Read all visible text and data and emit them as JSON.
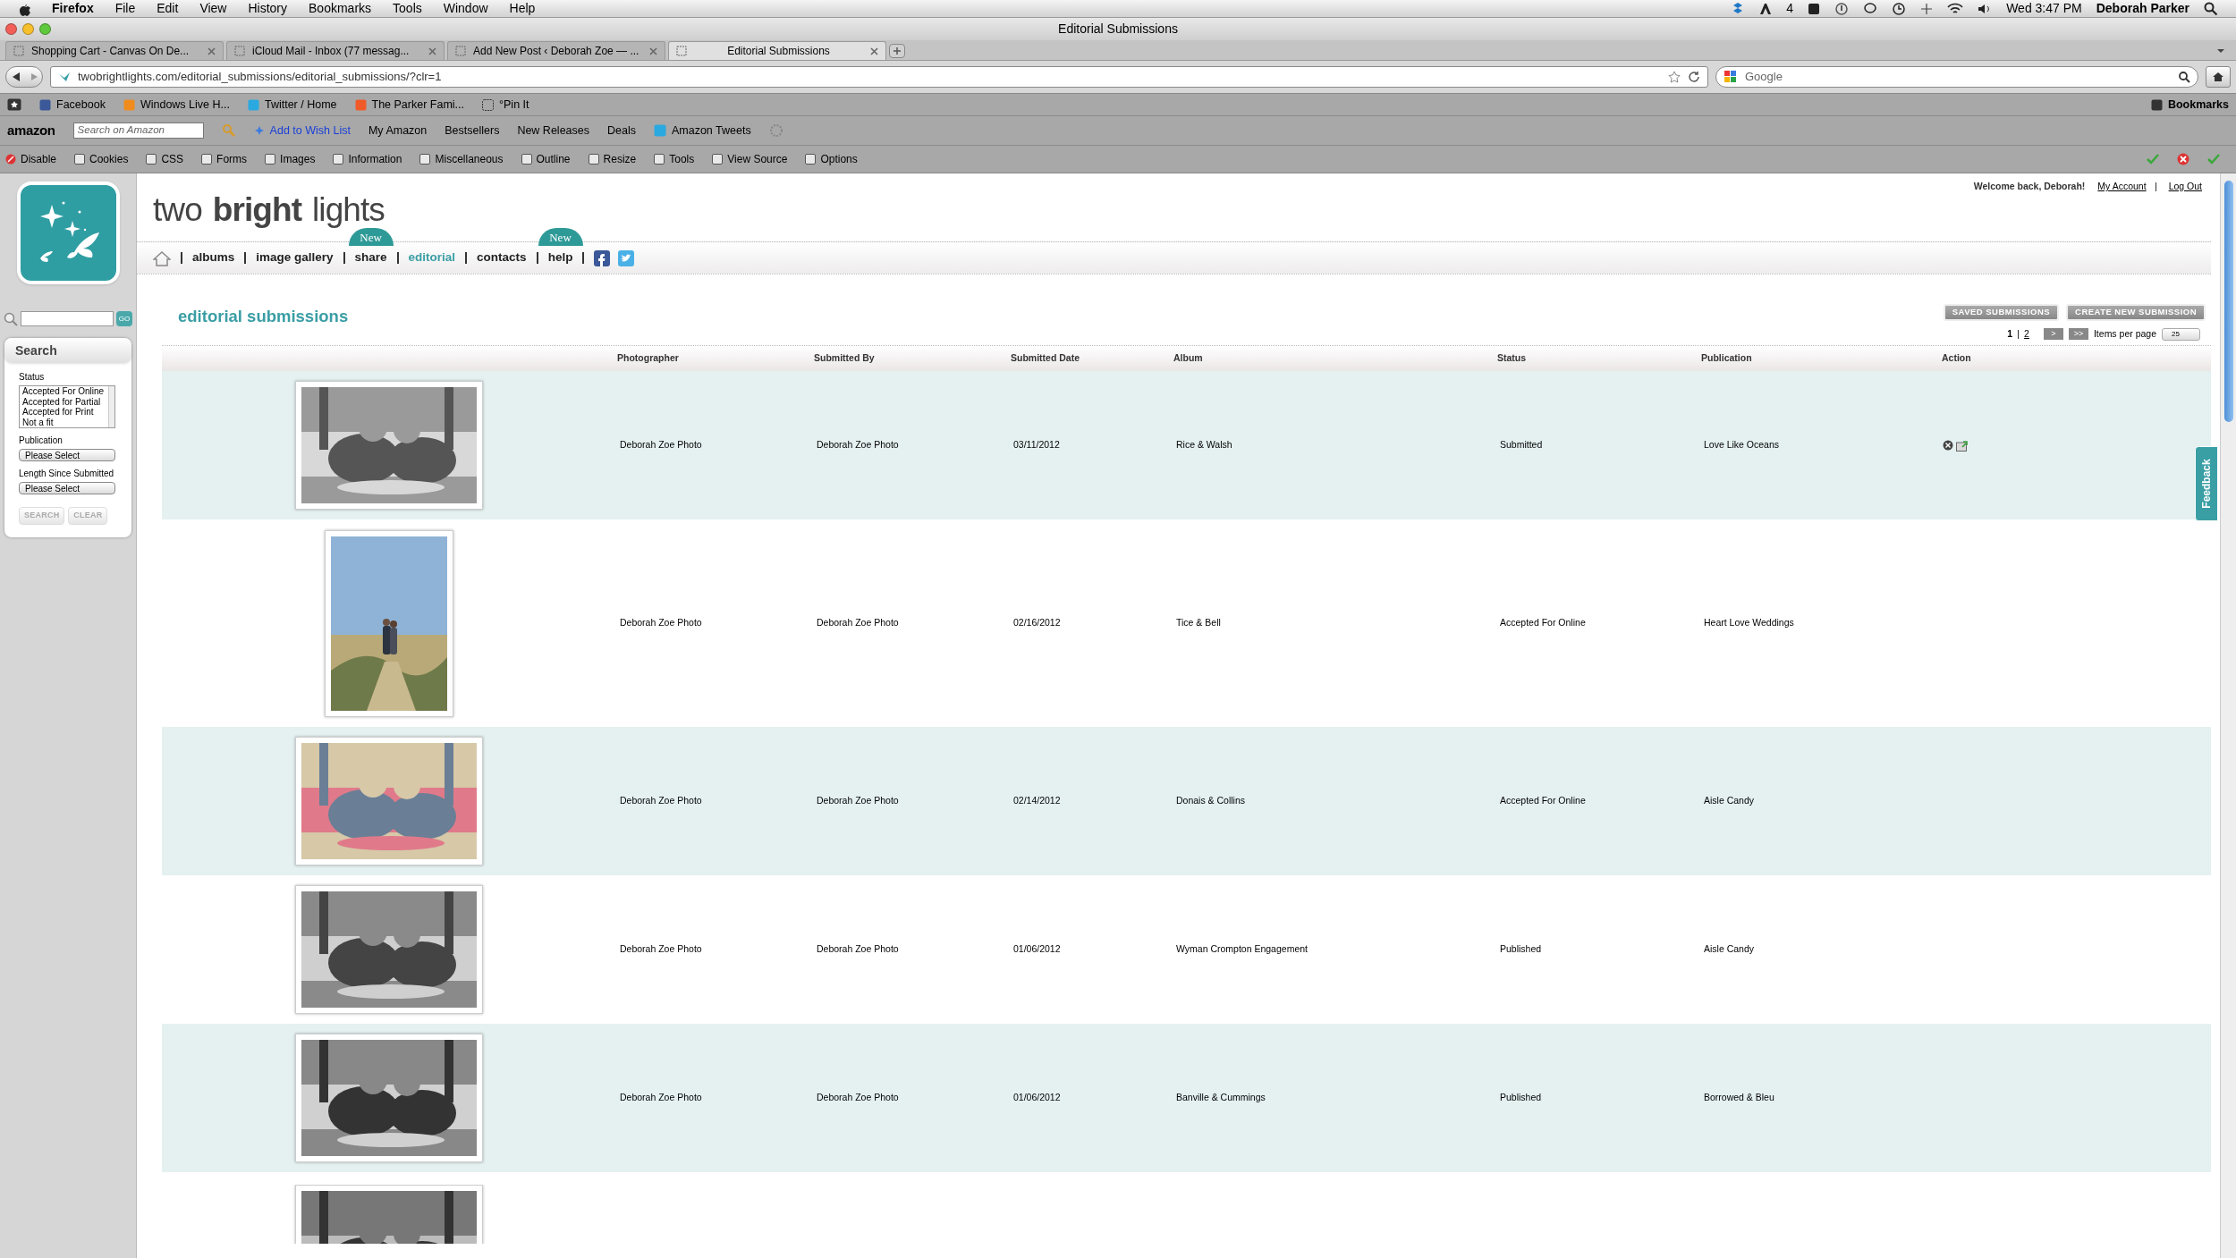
{
  "menu_bar": {
    "app": "Firefox",
    "items": [
      "File",
      "Edit",
      "View",
      "History",
      "Bookmarks",
      "Tools",
      "Window",
      "Help"
    ],
    "badge_count": "4",
    "clock": "Wed 3:47 PM",
    "user": "Deborah Parker"
  },
  "window": {
    "title": "Editorial Submissions"
  },
  "tabs": [
    {
      "label": "Shopping Cart - Canvas On De...",
      "selected": false
    },
    {
      "label": "iCloud Mail - Inbox (77 messag...",
      "selected": false
    },
    {
      "label": "Add New Post ‹ Deborah Zoe — ...",
      "selected": false
    },
    {
      "label": "Editorial Submissions",
      "selected": true
    }
  ],
  "address_bar": {
    "url": "twobrightlights.com/editorial_submissions/editorial_submissions/?clr=1"
  },
  "search_engine": {
    "placeholder": "Google"
  },
  "bookmarks_bar": {
    "items": [
      "Facebook",
      "Windows Live H...",
      "Twitter / Home",
      "The Parker Fami...",
      "°Pin It"
    ],
    "menu": "Bookmarks"
  },
  "amazon_toolbar": {
    "logo": "amazon",
    "search_placeholder": "Search on Amazon",
    "items": [
      "Add to Wish List",
      "My Amazon",
      "Bestsellers",
      "New Releases",
      "Deals",
      "Amazon Tweets"
    ]
  },
  "dev_toolbar": {
    "items": [
      "Disable",
      "Cookies",
      "CSS",
      "Forms",
      "Images",
      "Information",
      "Miscellaneous",
      "Outline",
      "Resize",
      "Tools",
      "View Source",
      "Options"
    ]
  },
  "site": {
    "logo_words": [
      "two",
      "bright",
      "lights"
    ],
    "nav": [
      {
        "label": "albums",
        "selected": false
      },
      {
        "label": "image gallery",
        "selected": false
      },
      {
        "label": "share",
        "selected": false,
        "badge": "New"
      },
      {
        "label": "editorial",
        "selected": true
      },
      {
        "label": "contacts",
        "selected": false
      },
      {
        "label": "help",
        "selected": false,
        "badge": "New"
      }
    ],
    "welcome": "Welcome back, Deborah!",
    "account_links": [
      "My Account",
      "Log Out"
    ]
  },
  "sidebar": {
    "go_button": "GO",
    "panel_title": "Search",
    "status_label": "Status",
    "status_options": [
      "Accepted For Online",
      "Accepted for Partial",
      "Accepted for Print",
      "Not a fit"
    ],
    "publication_label": "Publication",
    "publication_value": "Please Select",
    "length_label": "Length Since Submitted",
    "length_value": "Please Select",
    "buttons": [
      "SEARCH",
      "CLEAR"
    ]
  },
  "page_title": "editorial submissions",
  "actions": [
    "SAVED SUBMISSIONS",
    "CREATE NEW SUBMISSION"
  ],
  "pagination": {
    "pages": [
      {
        "label": "1",
        "selected": true
      },
      {
        "label": "2",
        "selected": false
      }
    ],
    "next": ">",
    "last": ">>",
    "per_page_label": "Items per page",
    "per_page_value": "25"
  },
  "table": {
    "columns": [
      "Photographer",
      "Submitted By",
      "Submitted Date",
      "Album",
      "Status",
      "Publication",
      "Action"
    ],
    "rows": [
      {
        "kind": "landscape",
        "cells": [
          "Deborah Zoe Photo",
          "Deborah Zoe Photo",
          "03/11/2012",
          "Rice & Walsh",
          "Submitted",
          "Love Like Oceans"
        ],
        "actions_shown": true
      },
      {
        "kind": "portrait",
        "cells": [
          "Deborah Zoe Photo",
          "Deborah Zoe Photo",
          "02/16/2012",
          "Tice & Bell",
          "Accepted For Online",
          "Heart Love Weddings"
        ],
        "actions_shown": false
      },
      {
        "kind": "landscape",
        "cells": [
          "Deborah Zoe Photo",
          "Deborah Zoe Photo",
          "02/14/2012",
          "Donais & Collins",
          "Accepted For Online",
          "Aisle Candy"
        ],
        "actions_shown": false
      },
      {
        "kind": "landscape",
        "cells": [
          "Deborah Zoe Photo",
          "Deborah Zoe Photo",
          "01/06/2012",
          "Wyman Crompton Engagement",
          "Published",
          "Aisle Candy"
        ],
        "actions_shown": false
      },
      {
        "kind": "landscape",
        "cells": [
          "Deborah Zoe Photo",
          "Deborah Zoe Photo",
          "01/06/2012",
          "Banville & Cummings",
          "Published",
          "Borrowed & Bleu"
        ],
        "actions_shown": false
      },
      {
        "kind": "landscape"
      }
    ]
  },
  "feedback_tab": "Feedback"
}
